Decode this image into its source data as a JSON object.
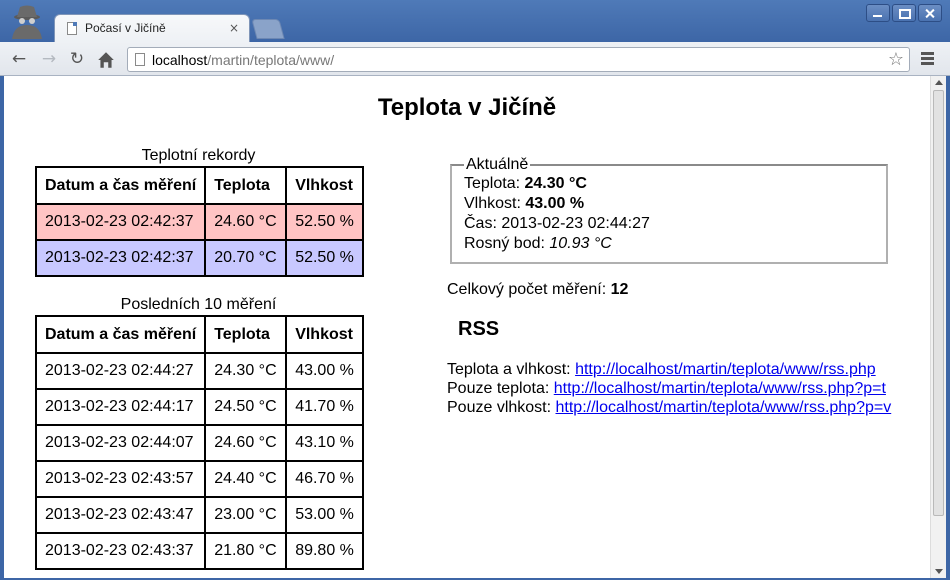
{
  "browser": {
    "tab_title": "Počasí v Jičíně",
    "tab_close": "×",
    "url_host": "localhost",
    "url_path": "/martin/teplota/www/"
  },
  "page": {
    "title": "Teplota v Jičíně",
    "records": {
      "caption": "Teplotní rekordy",
      "headers": [
        "Datum a čas měření",
        "Teplota",
        "Vlhkost"
      ],
      "max_color": "#ffc4c4",
      "min_color": "#c8c8ff",
      "rows": [
        [
          "2013-02-23 02:42:37",
          "24.60 °C",
          "52.50 %"
        ],
        [
          "2013-02-23 02:42:37",
          "20.70 °C",
          "52.50 %"
        ]
      ]
    },
    "last10": {
      "caption": "Posledních 10 měření",
      "headers": [
        "Datum a čas měření",
        "Teplota",
        "Vlhkost"
      ],
      "rows": [
        [
          "2013-02-23 02:44:27",
          "24.30 °C",
          "43.00 %"
        ],
        [
          "2013-02-23 02:44:17",
          "24.50 °C",
          "41.70 %"
        ],
        [
          "2013-02-23 02:44:07",
          "24.60 °C",
          "43.10 %"
        ],
        [
          "2013-02-23 02:43:57",
          "24.40 °C",
          "46.70 %"
        ],
        [
          "2013-02-23 02:43:47",
          "23.00 °C",
          "53.00 %"
        ],
        [
          "2013-02-23 02:43:37",
          "21.80 °C",
          "89.80 %"
        ]
      ]
    },
    "current": {
      "legend": "Aktuálně",
      "temp_label": "Teplota: ",
      "temp_value": "24.30 °C",
      "hum_label": "Vlhkost: ",
      "hum_value": "43.00 %",
      "time_label": "Čas: ",
      "time_value": "2013-02-23 02:44:27",
      "dew_label": "Rosný bod: ",
      "dew_value": "10.93 °C"
    },
    "total_label": "Celkový počet měření: ",
    "total_value": "12",
    "rss": {
      "title": "RSS",
      "links": [
        {
          "label": "Teplota a vlhkost: ",
          "url": "http://localhost/martin/teplota/www/rss.php"
        },
        {
          "label": "Pouze teplota: ",
          "url": "http://localhost/martin/teplota/www/rss.php?p=t"
        },
        {
          "label": "Pouze vlhkost: ",
          "url": "http://localhost/martin/teplota/www/rss.php?p=v"
        }
      ]
    }
  }
}
